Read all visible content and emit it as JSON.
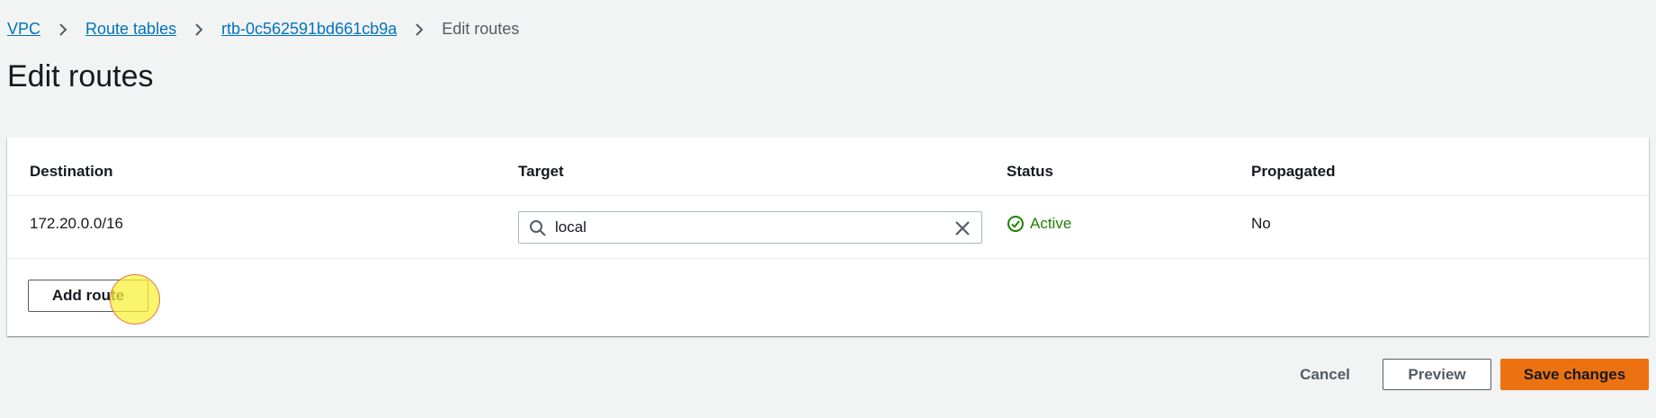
{
  "breadcrumb": {
    "items": [
      {
        "label": "VPC"
      },
      {
        "label": "Route tables"
      },
      {
        "label": "rtb-0c562591bd661cb9a"
      }
    ],
    "current": "Edit routes"
  },
  "page": {
    "title": "Edit routes"
  },
  "table": {
    "columns": [
      "Destination",
      "Target",
      "Status",
      "Propagated"
    ],
    "rows": [
      {
        "destination": "172.20.0.0/16",
        "target": "local",
        "status": "Active",
        "propagated": "No"
      }
    ]
  },
  "buttons": {
    "add_route": "Add route",
    "cancel": "Cancel",
    "preview": "Preview",
    "save_changes": "Save changes"
  },
  "icons": {
    "breadcrumb_separator": "chevron-right-icon",
    "target_search": "search-icon",
    "target_clear": "close-icon",
    "status": "check-circle-icon"
  },
  "colors": {
    "link": "#0073bb",
    "status_active": "#1d8102",
    "primary_button": "#ec7211",
    "background": "#f2f3f3"
  }
}
